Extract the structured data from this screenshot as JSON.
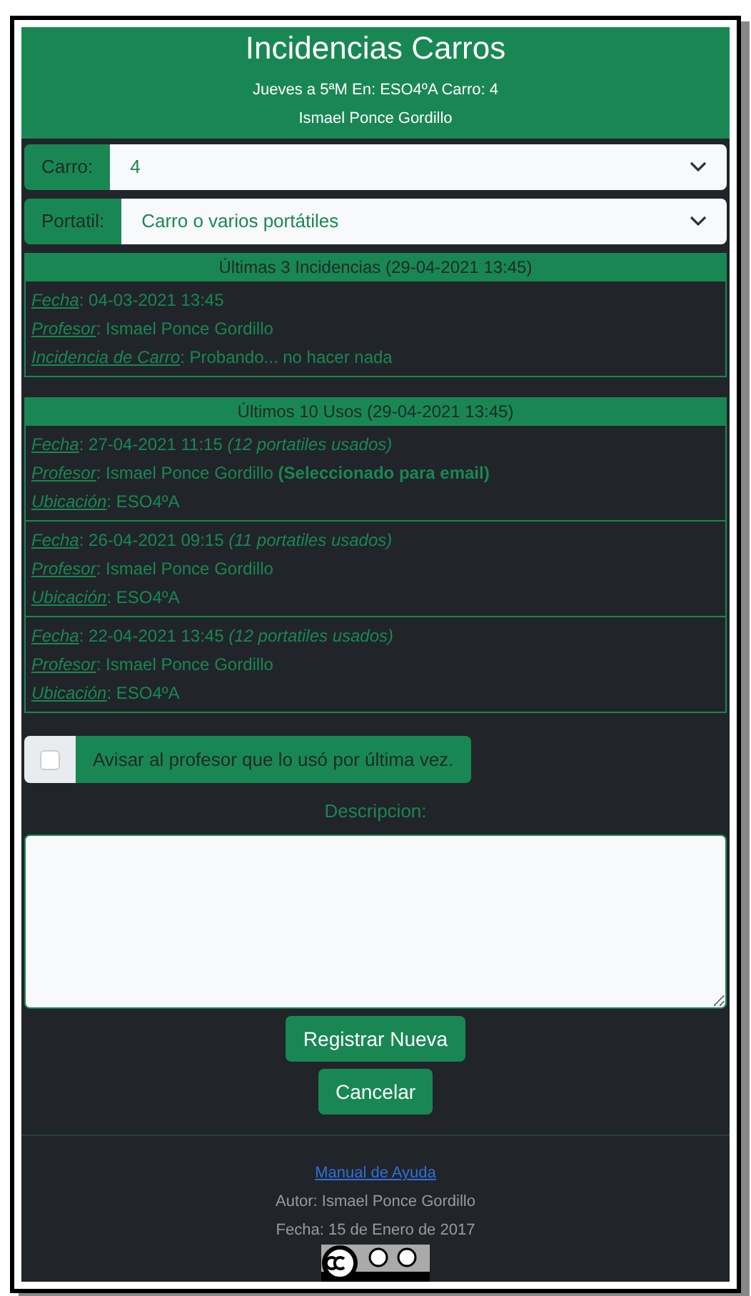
{
  "header": {
    "title": "Incidencias Carros",
    "subtitle": "Jueves a 5ªM En: ESO4ºA Carro: 4",
    "user": "Ismael Ponce Gordillo"
  },
  "selects": [
    {
      "label": "Carro:",
      "value": "4"
    },
    {
      "label": "Portatil:",
      "value": "Carro o varios portátiles"
    }
  ],
  "incidents": {
    "title": "Últimas 3 Incidencias (29-04-2021 13:45)",
    "items": [
      {
        "fields": [
          {
            "label": "Fecha",
            "value": ": 04-03-2021 13:45"
          },
          {
            "label": "Profesor",
            "value": ": Ismael Ponce Gordillo"
          },
          {
            "label": "Incidencia de Carro",
            "value": ": Probando... no hacer nada"
          }
        ]
      }
    ]
  },
  "uses": {
    "title": "Últimos 10 Usos (29-04-2021 13:45)",
    "items": [
      {
        "fields": [
          {
            "label": "Fecha",
            "value": ": 27-04-2021 11:15",
            "note": "(12 portatiles usados)"
          },
          {
            "label": "Profesor",
            "value": ": Ismael Ponce Gordillo",
            "strong": "(Seleccionado para email)"
          },
          {
            "label": "Ubicación",
            "value": ": ESO4ºA"
          }
        ]
      },
      {
        "fields": [
          {
            "label": "Fecha",
            "value": ": 26-04-2021 09:15",
            "note": "(11 portatiles usados)"
          },
          {
            "label": "Profesor",
            "value": ": Ismael Ponce Gordillo"
          },
          {
            "label": "Ubicación",
            "value": ": ESO4ºA"
          }
        ]
      },
      {
        "fields": [
          {
            "label": "Fecha",
            "value": ": 22-04-2021 13:45",
            "note": "(12 portatiles usados)"
          },
          {
            "label": "Profesor",
            "value": ": Ismael Ponce Gordillo"
          },
          {
            "label": "Ubicación",
            "value": ": ESO4ºA"
          }
        ]
      }
    ]
  },
  "notify": {
    "label": "Avisar al profesor que lo usó por última vez.",
    "checked": false
  },
  "description": {
    "label": "Descripcion:"
  },
  "buttons": [
    "Registrar Nueva",
    "Cancelar"
  ],
  "footer": {
    "link": "Manual de Ayuda",
    "author": "Autor: Ismael Ponce Gordillo",
    "date": "Fecha: 15 de Enero de 2017"
  }
}
